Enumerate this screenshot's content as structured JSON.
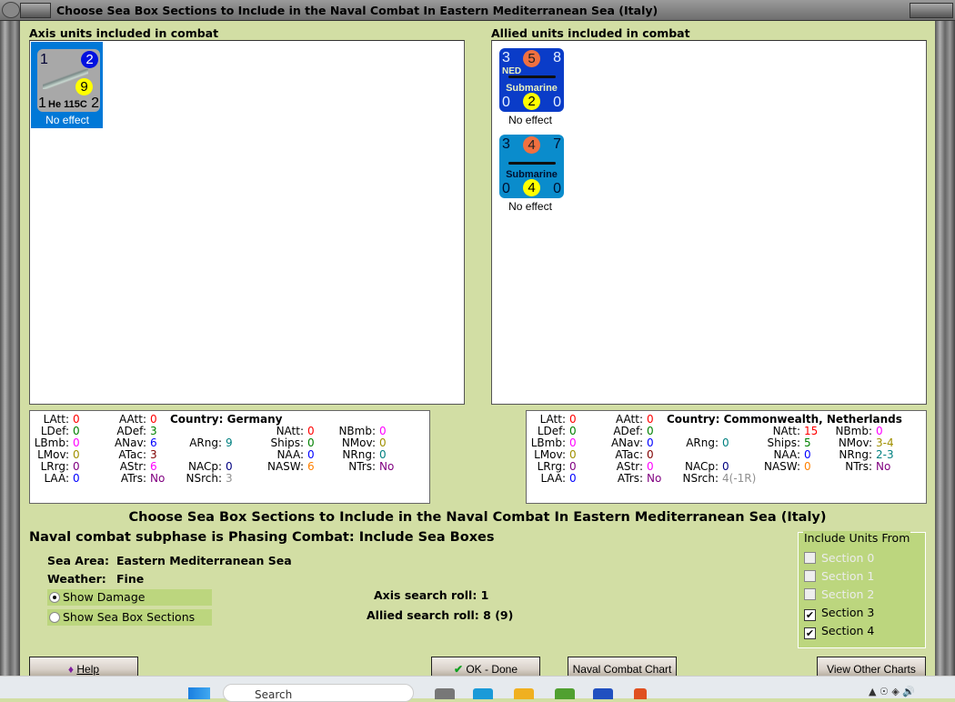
{
  "window": {
    "title": "Choose Sea Box Sections to Include in the Naval Combat In Eastern Mediterranean Sea (Italy)"
  },
  "axis": {
    "label": "Axis units included in combat",
    "units": [
      {
        "tl": "1",
        "tr": "2",
        "br": "2",
        "bl": "1",
        "name": "He 115C",
        "circle": "9",
        "status": "No effect",
        "color": "#a8a8a8",
        "selected": true
      }
    ]
  },
  "allied": {
    "label": "Allied units included in combat",
    "units": [
      {
        "tl": "3",
        "tc": "5",
        "tr": "8",
        "flag": "NED",
        "name": "Submarine",
        "bl": "0",
        "bc": "2",
        "br": "0",
        "status": "No effect",
        "color": "#0a3cc8"
      },
      {
        "tl": "3",
        "tc": "4",
        "tr": "7",
        "flag": "",
        "name": "Submarine",
        "bl": "0",
        "bc": "4",
        "br": "0",
        "status": "No effect",
        "color": "#0a8ccc"
      }
    ]
  },
  "axis_stats": {
    "country": "Country: Germany",
    "rows": [
      [
        {
          "k": "LAtt:",
          "v": "0",
          "c": "#ff0000"
        },
        {
          "k": "AAtt:",
          "v": "0",
          "c": "#ff0000"
        },
        null,
        null,
        null
      ],
      [
        {
          "k": "LDef:",
          "v": "0",
          "c": "#008000"
        },
        {
          "k": "ADef:",
          "v": "3",
          "c": "#008000"
        },
        null,
        {
          "k": "NAtt:",
          "v": "0",
          "c": "#ff0000"
        },
        {
          "k": "NBmb:",
          "v": "0",
          "c": "#ff00ff"
        }
      ],
      [
        {
          "k": "LBmb:",
          "v": "0",
          "c": "#ff00ff"
        },
        {
          "k": "ANav:",
          "v": "6",
          "c": "#0000ff"
        },
        {
          "k": "ARng:",
          "v": "9",
          "c": "#008080"
        },
        {
          "k": "Ships:",
          "v": "0",
          "c": "#008000"
        },
        {
          "k": "NMov:",
          "v": "0",
          "c": "#a09000"
        }
      ],
      [
        {
          "k": "LMov:",
          "v": "0",
          "c": "#a09000"
        },
        {
          "k": "ATac:",
          "v": "3",
          "c": "#800000"
        },
        null,
        {
          "k": "NAA:",
          "v": "0",
          "c": "#0000ff"
        },
        {
          "k": "NRng:",
          "v": "0",
          "c": "#008080"
        }
      ],
      [
        {
          "k": "LRrg:",
          "v": "0",
          "c": "#800080"
        },
        {
          "k": "AStr:",
          "v": "6",
          "c": "#ff00ff"
        },
        {
          "k": "NACp:",
          "v": "0",
          "c": "#000080"
        },
        {
          "k": "NASW:",
          "v": "6",
          "c": "#ff8000"
        },
        {
          "k": "NTrs:",
          "v": "No",
          "c": "#800080"
        }
      ],
      [
        {
          "k": "LAA:",
          "v": "0",
          "c": "#0000ff"
        },
        {
          "k": "ATrs:",
          "v": "No",
          "c": "#800080"
        },
        {
          "k": "NSrch:",
          "v": "3",
          "c": "#909090"
        },
        null,
        null
      ]
    ]
  },
  "allied_stats": {
    "country": "Country: Commonwealth, Netherlands",
    "rows": [
      [
        {
          "k": "LAtt:",
          "v": "0",
          "c": "#ff0000"
        },
        {
          "k": "AAtt:",
          "v": "0",
          "c": "#ff0000"
        },
        null,
        null,
        null
      ],
      [
        {
          "k": "LDef:",
          "v": "0",
          "c": "#008000"
        },
        {
          "k": "ADef:",
          "v": "0",
          "c": "#008000"
        },
        null,
        {
          "k": "NAtt:",
          "v": "15",
          "c": "#ff0000"
        },
        {
          "k": "NBmb:",
          "v": "0",
          "c": "#ff00ff"
        }
      ],
      [
        {
          "k": "LBmb:",
          "v": "0",
          "c": "#ff00ff"
        },
        {
          "k": "ANav:",
          "v": "0",
          "c": "#0000ff"
        },
        {
          "k": "ARng:",
          "v": "0",
          "c": "#008080"
        },
        {
          "k": "Ships:",
          "v": "5",
          "c": "#008000"
        },
        {
          "k": "NMov:",
          "v": "3-4",
          "c": "#a09000"
        }
      ],
      [
        {
          "k": "LMov:",
          "v": "0",
          "c": "#a09000"
        },
        {
          "k": "ATac:",
          "v": "0",
          "c": "#800000"
        },
        null,
        {
          "k": "NAA:",
          "v": "0",
          "c": "#0000ff"
        },
        {
          "k": "NRng:",
          "v": "2-3",
          "c": "#008080"
        }
      ],
      [
        {
          "k": "LRrg:",
          "v": "0",
          "c": "#800080"
        },
        {
          "k": "AStr:",
          "v": "0",
          "c": "#ff00ff"
        },
        {
          "k": "NACp:",
          "v": "0",
          "c": "#000080"
        },
        {
          "k": "NASW:",
          "v": "0",
          "c": "#ff8000"
        },
        {
          "k": "NTrs:",
          "v": "No",
          "c": "#800080"
        }
      ],
      [
        {
          "k": "LAA:",
          "v": "0",
          "c": "#0000ff"
        },
        {
          "k": "ATrs:",
          "v": "No",
          "c": "#800080"
        },
        {
          "k": "NSrch:",
          "v": "4(-1R)",
          "c": "#909090"
        },
        null,
        null
      ]
    ]
  },
  "main": {
    "heading": "Choose Sea Box Sections to Include in the Naval Combat In Eastern Mediterranean Sea (Italy)",
    "subphase": "Naval combat subphase is Phasing Combat: Include Sea Boxes",
    "sea_area_label": "Sea Area:",
    "sea_area": "Eastern Mediterranean Sea",
    "weather_label": "Weather:",
    "weather": "Fine",
    "axis_roll": "Axis search roll: 1",
    "allied_roll": "Allied search roll: 8 (9)",
    "radios": [
      {
        "label": "Show Damage",
        "selected": true
      },
      {
        "label": "Show Sea Box Sections",
        "selected": false
      }
    ]
  },
  "sections": {
    "legend": "Include Units From",
    "items": [
      {
        "label": "Section 0",
        "checked": false,
        "enabled": false
      },
      {
        "label": "Section 1",
        "checked": false,
        "enabled": false
      },
      {
        "label": "Section 2",
        "checked": false,
        "enabled": false
      },
      {
        "label": "Section 3",
        "checked": true,
        "enabled": true
      },
      {
        "label": "Section 4",
        "checked": true,
        "enabled": true
      }
    ]
  },
  "buttons": {
    "help": "Help",
    "ok": "OK - Done",
    "naval_chart": "Naval Combat Chart",
    "other_charts": "View Other Charts"
  },
  "taskbar": {
    "search": "Search"
  }
}
